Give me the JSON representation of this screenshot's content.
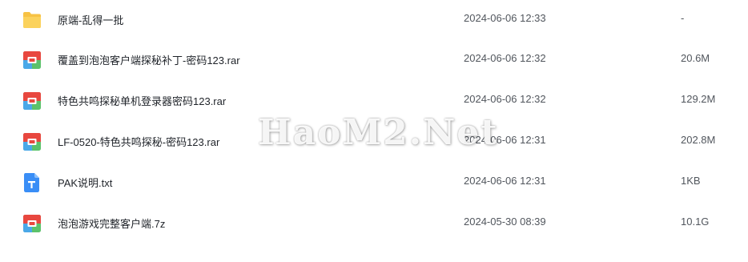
{
  "files": [
    {
      "name": "原端-乱得一批",
      "date": "2024-06-06 12:33",
      "size": "-",
      "icon": "folder-icon"
    },
    {
      "name": "覆盖到泡泡客户端探秘补丁-密码123.rar",
      "date": "2024-06-06 12:32",
      "size": "20.6M",
      "icon": "archive-icon"
    },
    {
      "name": "特色共鸣探秘单机登录器密码123.rar",
      "date": "2024-06-06 12:32",
      "size": "129.2M",
      "icon": "archive-icon"
    },
    {
      "name": "LF-0520-特色共鸣探秘-密码123.rar",
      "date": "2024-06-06 12:31",
      "size": "202.8M",
      "icon": "archive-icon"
    },
    {
      "name": "PAK说明.txt",
      "date": "2024-06-06 12:31",
      "size": "1KB",
      "icon": "text-file-icon"
    },
    {
      "name": "泡泡游戏完整客户端.7z",
      "date": "2024-05-30 08:39",
      "size": "10.1G",
      "icon": "archive-icon"
    }
  ],
  "watermark": "HaoM2.Net",
  "colors": {
    "folder": "#f7c244",
    "archive_top": "#e8473f",
    "archive_bottom_left": "#4aa8e8",
    "archive_bottom_right": "#5cc26b",
    "text_file": "#3a8ef6"
  }
}
